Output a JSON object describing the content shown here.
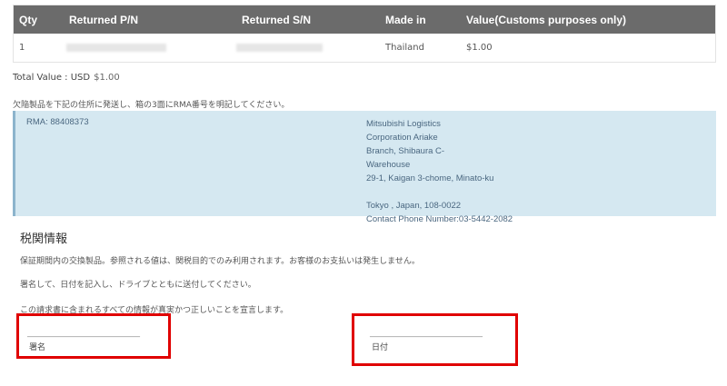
{
  "table": {
    "headers": [
      "Qty",
      "Returned P/N",
      "Returned S/N",
      "Made in",
      "Value(Customs purposes only)"
    ],
    "rows": [
      {
        "qty": "1",
        "made_in": "Thailand",
        "value": "$1.00"
      }
    ]
  },
  "total": {
    "label": "Total Value : USD",
    "value": "$1.00"
  },
  "instruction": "欠陥製品を下記の住所に発送し、箱の3面にRMA番号を明記してください。",
  "shipping": {
    "rma": "RMA: 88408373",
    "address_lines": [
      "Mitsubishi Logistics",
      "Corporation Ariake",
      "Branch, Shibaura C-",
      "Warehouse",
      "29-1, Kaigan 3-chome, Minato-ku",
      "",
      "Tokyo , Japan, 108-0022",
      "Contact Phone Number:03-5442-2082"
    ]
  },
  "customs": {
    "title": "税関情報",
    "paragraph1": "保証期間内の交換製品。参照される値は、関税目的でのみ利用されます。お客様のお支払いは発生しません。",
    "paragraph2": "署名して、日付を記入し、ドライブとともに送付してください。",
    "paragraph3": "この請求書に含まれるすべての情報が真実かつ正しいことを宣言します。",
    "signature_line": "_______________________________",
    "signature_label": "署名",
    "date_line": "_______________________________",
    "date_label": "日付"
  },
  "colors": {
    "header_bg": "#6b6b6b",
    "info_box_bg": "#d5e8f1",
    "highlight": "#e00000"
  }
}
